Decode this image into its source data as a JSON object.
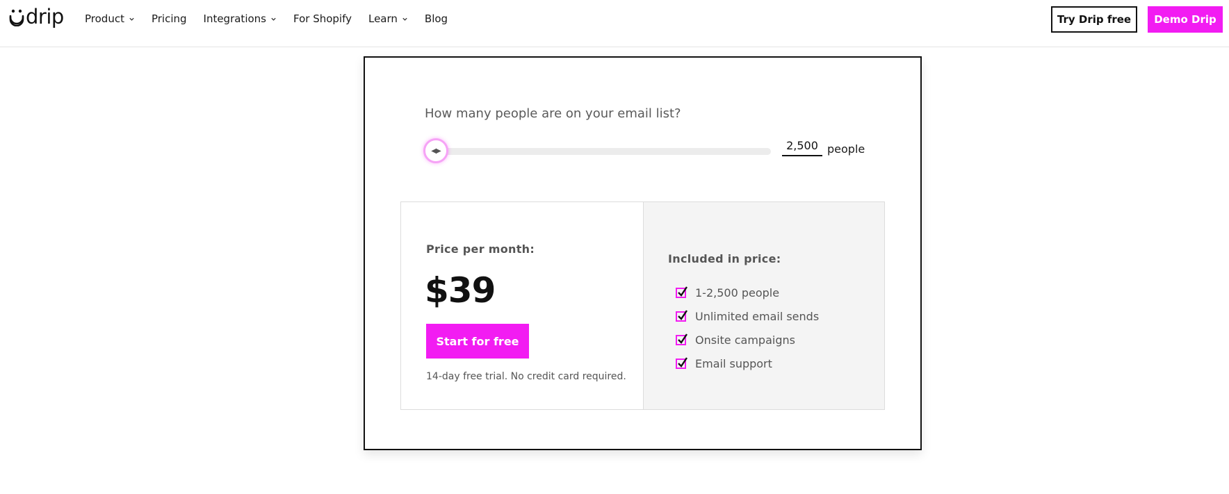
{
  "brand": {
    "name": "drip",
    "accent": "#f21cf2"
  },
  "nav": {
    "items": [
      {
        "label": "Product",
        "has_dropdown": true
      },
      {
        "label": "Pricing",
        "has_dropdown": false
      },
      {
        "label": "Integrations",
        "has_dropdown": true
      },
      {
        "label": "For Shopify",
        "has_dropdown": false
      },
      {
        "label": "Learn",
        "has_dropdown": true
      },
      {
        "label": "Blog",
        "has_dropdown": false
      }
    ],
    "try_label": "Try Drip free",
    "demo_label": "Demo Drip"
  },
  "calculator": {
    "question": "How many people are on your email list?",
    "people_value": "2,500",
    "people_unit": "people",
    "slider_fraction": 0.0
  },
  "pricing": {
    "price_label": "Price per month:",
    "price": "$39",
    "cta_label": "Start for free",
    "trial_note": "14-day free trial. No credit card required.",
    "included_label": "Included in price:",
    "features": [
      "1-2,500 people",
      "Unlimited email sends",
      "Onsite campaigns",
      "Email support"
    ]
  }
}
